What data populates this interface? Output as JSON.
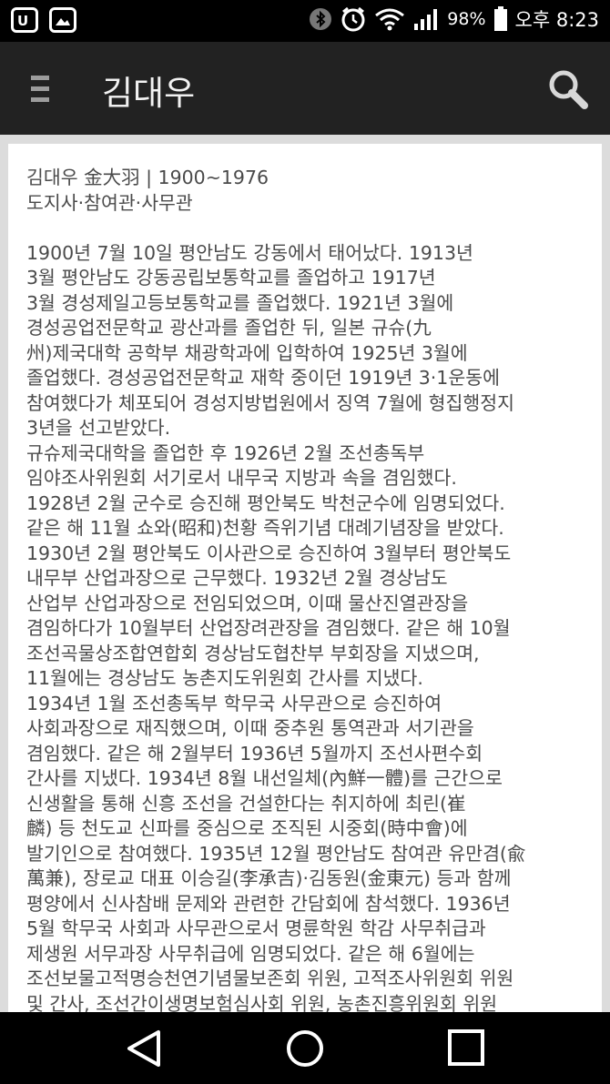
{
  "status_bar": {
    "left_icons": [
      "u-plus-icon",
      "image-icon"
    ],
    "right_icons": [
      "bluetooth-icon",
      "alarm-icon",
      "wifi-icon",
      "signal-icon",
      "battery-icon"
    ],
    "battery_percent": "98%",
    "time": "오후 8:23"
  },
  "app_bar": {
    "title": "김대우"
  },
  "article": {
    "lines": [
      "김대우 金大羽 | 1900~1976",
      "도지사·참여관·사무관",
      "",
      "1900년 7월 10일 평안남도 강동에서 태어났다. 1913년",
      "3월 평안남도 강동공립보통학교를 졸업하고 1917년",
      "3월 경성제일고등보통학교를 졸업했다. 1921년 3월에",
      "경성공업전문학교 광산과를 졸업한 뒤, 일본 규슈(九",
      "州)제국대학 공학부 채광학과에 입학하여 1925년 3월에",
      "졸업했다. 경성공업전문학교 재학 중이던 1919년 3·1운동에",
      "참여했다가 체포되어 경성지방법원에서 징역 7월에 형집행정지",
      "3년을 선고받았다.",
      "규슈제국대학을 졸업한 후 1926년 2월 조선총독부",
      "임야조사위원회 서기로서 내무국 지방과 속을 겸임했다.",
      "1928년 2월 군수로 승진해 평안북도 박천군수에 임명되었다.",
      "같은 해 11월 쇼와(昭和)천황 즉위기념 대례기념장을 받았다.",
      "1930년 2월 평안북도 이사관으로 승진하여 3월부터 평안북도",
      "내무부 산업과장으로 근무했다. 1932년 2월 경상남도",
      "산업부 산업과장으로 전임되었으며, 이때 물산진열관장을",
      "겸임하다가 10월부터 산업장려관장을 겸임했다. 같은 해 10월",
      "조선곡물상조합연합회 경상남도협찬부 부회장을 지냈으며,",
      "11월에는 경상남도 농촌지도위원회 간사를 지냈다.",
      "1934년 1월 조선총독부 학무국 사무관으로 승진하여",
      "사회과장으로 재직했으며, 이때 중추원 통역관과 서기관을",
      "겸임했다. 같은 해 2월부터 1936년 5월까지 조선사편수회",
      "간사를 지냈다. 1934년 8월 내선일체(內鮮一體)를 근간으로",
      "신생활을 통해 신흥 조선을 건설한다는 취지하에 최린(崔",
      "麟) 등 천도교 신파를 중심으로 조직된 시중회(時中會)에",
      "발기인으로 참여했다. 1935년 12월 평안남도 참여관 유만겸(兪",
      "萬兼), 장로교 대표 이승길(李承吉)·김동원(金東元) 등과 함께",
      "평양에서 신사참배 문제와 관련한 간담회에 참석했다. 1936년",
      "5월 학무국 사회과 사무관으로서 명륜학원 학감 사무취급과",
      "제생원 서무과장 사무취급에 임명되었다. 같은 해 6월에는",
      "조선보물고적명승천연기념물보존회 위원, 고적조사위원회 위원",
      "및 간사, 조선간이생명보험심사회 위원, 농촌진흥위원회 위원"
    ]
  },
  "nav_bar": {
    "buttons": [
      "back-icon",
      "home-icon",
      "recents-icon"
    ]
  }
}
